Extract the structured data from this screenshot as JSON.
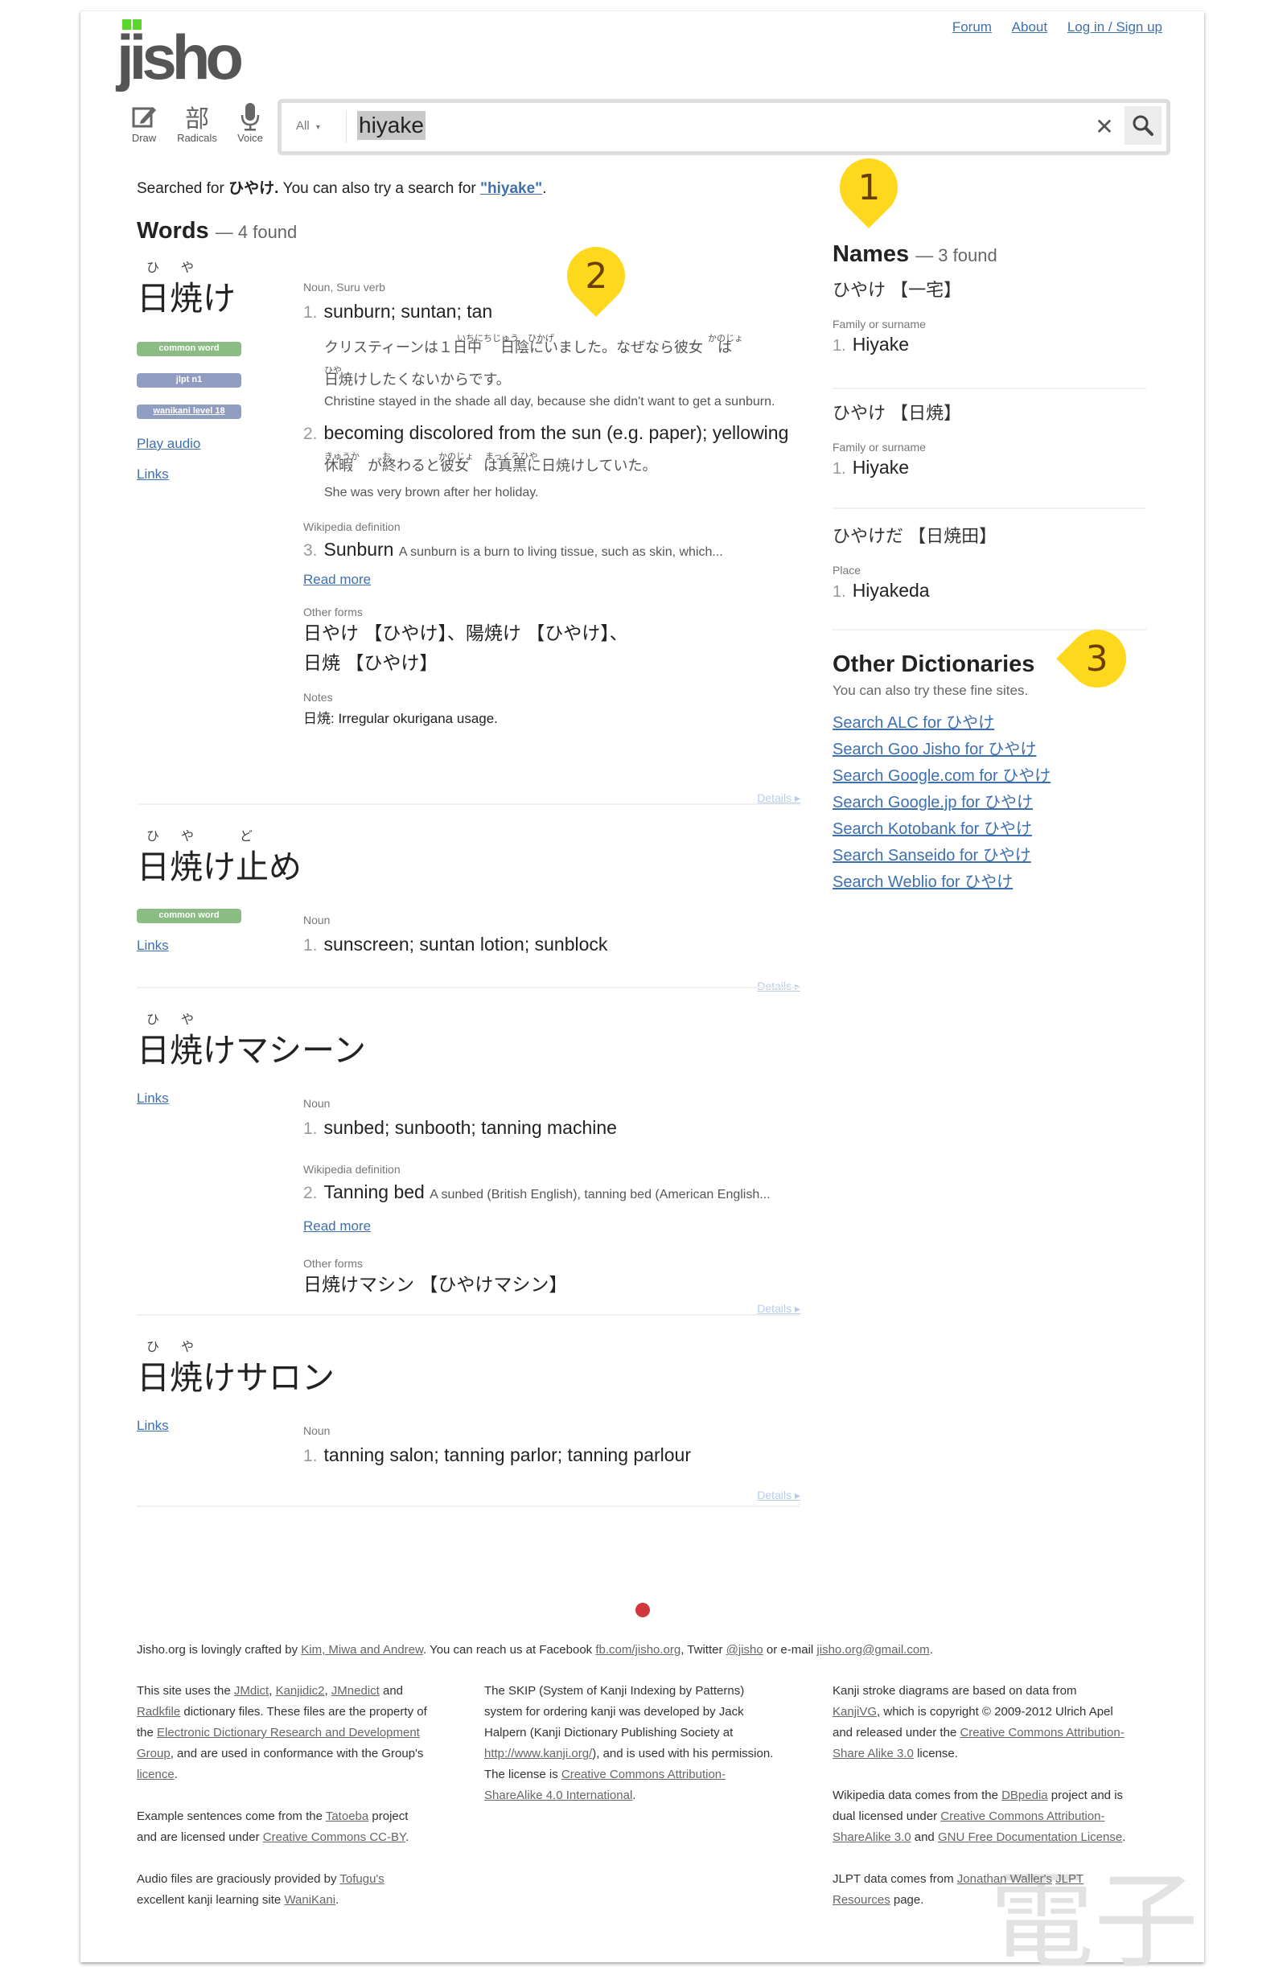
{
  "header": {
    "logo_text": "jisho",
    "nav_links": [
      "Forum",
      "About",
      "Log in / Sign up"
    ],
    "tools": [
      {
        "label": "Draw",
        "icon": "pencil-icon"
      },
      {
        "label": "Radicals",
        "icon": "radicals-icon",
        "glyph": "部"
      },
      {
        "label": "Voice",
        "icon": "microphone-icon"
      }
    ],
    "search": {
      "filter": "All",
      "filter_arrow": "▾",
      "query": "hiyake",
      "clear_glyph": "✕"
    }
  },
  "searched": {
    "prefix": "Searched for ",
    "term": "ひやけ.",
    "middle": " You can also try a search for ",
    "alt": "\"hiyake\"",
    "suffix": "."
  },
  "words": {
    "title": "Words",
    "count": "— 4 found",
    "entries": [
      {
        "furigana": [
          "ひ",
          "や"
        ],
        "word": "日焼け",
        "tags": [
          "common word",
          "jlpt n1",
          "wanikani level 18"
        ],
        "play_audio": "Play audio",
        "links": "Links",
        "pos1": "Noun, Suru verb",
        "meaning1_num": "1.",
        "meaning1": "sunburn; suntan; tan",
        "ex1_ruby": [
          "いちにちじゅう",
          "ひかげ",
          "かのじょ",
          "ひや"
        ],
        "ex1_jp_line1": "クリスティーンは１日中　 日陰にいました。なぜなら彼女　は",
        "ex1_jp_line2": "日焼けしたくないからです。",
        "ex1_en": "Christine stayed in the shade all day, because she didn't want to get a sunburn.",
        "meaning2_num": "2.",
        "meaning2": "becoming discolored from the sun (e.g. paper); yellowing",
        "ex2_ruby": [
          "きゅうか",
          "お",
          "かのじょ",
          "まっくろひや"
        ],
        "ex2_jp": "休暇　が終わると彼女　は真黒に日焼けしていた。",
        "ex2_en": "She was very brown after her holiday.",
        "wiki_label": "Wikipedia definition",
        "meaning3_num": "3.",
        "wiki_title": "Sunburn",
        "wiki_desc": "A sunburn is a burn to living tissue, such as skin, which...",
        "read_more": "Read more",
        "other_forms_label": "Other forms",
        "other_forms_line1": "日やけ 【ひやけ】、陽焼け 【ひやけ】、",
        "other_forms_line2": "日焼 【ひやけ】",
        "notes_label": "Notes",
        "notes": "日焼: Irregular okurigana usage.",
        "details": "Details ▸"
      },
      {
        "furigana": [
          "ひ",
          "や",
          "ど"
        ],
        "word": "日焼け止め",
        "tags": [
          "common word"
        ],
        "links": "Links",
        "pos1": "Noun",
        "meaning1_num": "1.",
        "meaning1": "sunscreen; suntan lotion; sunblock",
        "details": "Details ▸"
      },
      {
        "furigana": [
          "ひ",
          "や"
        ],
        "word": "日焼けマシーン",
        "links": "Links",
        "pos1": "Noun",
        "meaning1_num": "1.",
        "meaning1": "sunbed; sunbooth; tanning machine",
        "wiki_label": "Wikipedia definition",
        "meaning2_num": "2.",
        "wiki_title": "Tanning bed",
        "wiki_desc": "A sunbed (British English), tanning bed (American English...",
        "read_more": " Read more",
        "other_forms_label": "Other forms",
        "other_forms_line1": "日焼けマシン 【ひやけマシン】",
        "details": "Details ▸"
      },
      {
        "furigana": [
          "ひ",
          "や"
        ],
        "word": "日焼けサロン",
        "links": "Links",
        "pos1": "Noun",
        "meaning1_num": "1.",
        "meaning1": "tanning salon; tanning parlor; tanning parlour",
        "details": "Details ▸"
      }
    ]
  },
  "names": {
    "title": "Names",
    "count": "— 3 found",
    "items": [
      {
        "heading": "ひやけ 【一宅】",
        "type": "Family or surname",
        "num": "1.",
        "value": "Hiyake"
      },
      {
        "heading": "ひやけ 【日焼】",
        "type": "Family or surname",
        "num": "1.",
        "value": "Hiyake"
      },
      {
        "heading": "ひやけだ 【日焼田】",
        "type": "Place",
        "num": "1.",
        "value": "Hiyakeda"
      }
    ]
  },
  "other_dictionaries": {
    "title": "Other Dictionaries",
    "subtitle": "You can also try these fine sites.",
    "links": [
      "Search ALC for ひやけ",
      "Search Goo Jisho for ひやけ",
      "Search Google.com for ひやけ",
      "Search Google.jp for ひやけ",
      "Search Kotobank for ひやけ",
      "Search Sanseido for ひやけ",
      "Search Weblio for ひやけ"
    ]
  },
  "markers": [
    "1",
    "2",
    "3"
  ],
  "marker_color": "#fed81c",
  "footer": {
    "credit": {
      "t1": "Jisho.org is lovingly crafted by ",
      "l1": "Kim, Miwa and Andrew",
      "t2": ". You can reach us at Facebook ",
      "l2": "fb.com/jisho.org",
      "t3": ", Twitter ",
      "l3": "@jisho",
      "t4": " or e-mail ",
      "l4": "jisho.org@gmail.com",
      "t5": "."
    },
    "col1": {
      "p1": {
        "t1": "This site uses the ",
        "l1": "JMdict",
        "t2": ", ",
        "l2": "Kanjidic2",
        "t3": ", ",
        "l3": "JMnedict",
        "t4": " and ",
        "l4": "Radkfile",
        "t5": " dictionary files. These files are the property of the ",
        "l5": "Electronic Dictionary Research and Development Group",
        "t6": ", and are used in conformance with the Group's ",
        "l6": "licence",
        "t7": "."
      },
      "p2": {
        "t1": "Example sentences come from the ",
        "l1": "Tatoeba",
        "t2": " project and are licensed under ",
        "l2": "Creative Commons CC-BY",
        "t3": "."
      },
      "p3": {
        "t1": "Audio files are graciously provided by ",
        "l1": "Tofugu's",
        "t2": " excellent kanji learning site ",
        "l2": "WaniKani",
        "t3": "."
      }
    },
    "col2": {
      "p1": {
        "t1": "The SKIP (System of Kanji Indexing by Patterns) system for ordering kanji was developed by Jack Halpern (Kanji Dictionary Publishing Society at ",
        "l1": "http://www.kanji.org/",
        "t2": "), and is used with his permission. The license is ",
        "l2": "Creative Commons Attribution-ShareAlike 4.0 International",
        "t3": "."
      }
    },
    "col3": {
      "p1": {
        "t1": "Kanji stroke diagrams are based on data from ",
        "l1": "KanjiVG",
        "t2": ", which is copyright © 2009-2012 Ulrich Apel and released under the ",
        "l2": "Creative Commons Attribution-Share Alike 3.0",
        "t3": " license."
      },
      "p2": {
        "t1": "Wikipedia data comes from the ",
        "l1": "DBpedia",
        "t2": " project and is dual licensed under ",
        "l2": "Creative Commons Attribution-ShareAlike 3.0",
        "t3": " and ",
        "l3": "GNU Free Documentation License",
        "t4": "."
      },
      "p3": {
        "t1": "JLPT data comes from ",
        "l1": "Jonathan Waller's",
        "t2": " ",
        "l2": "JLPT Resources",
        "t3": " page."
      }
    },
    "watermark": "電子"
  }
}
